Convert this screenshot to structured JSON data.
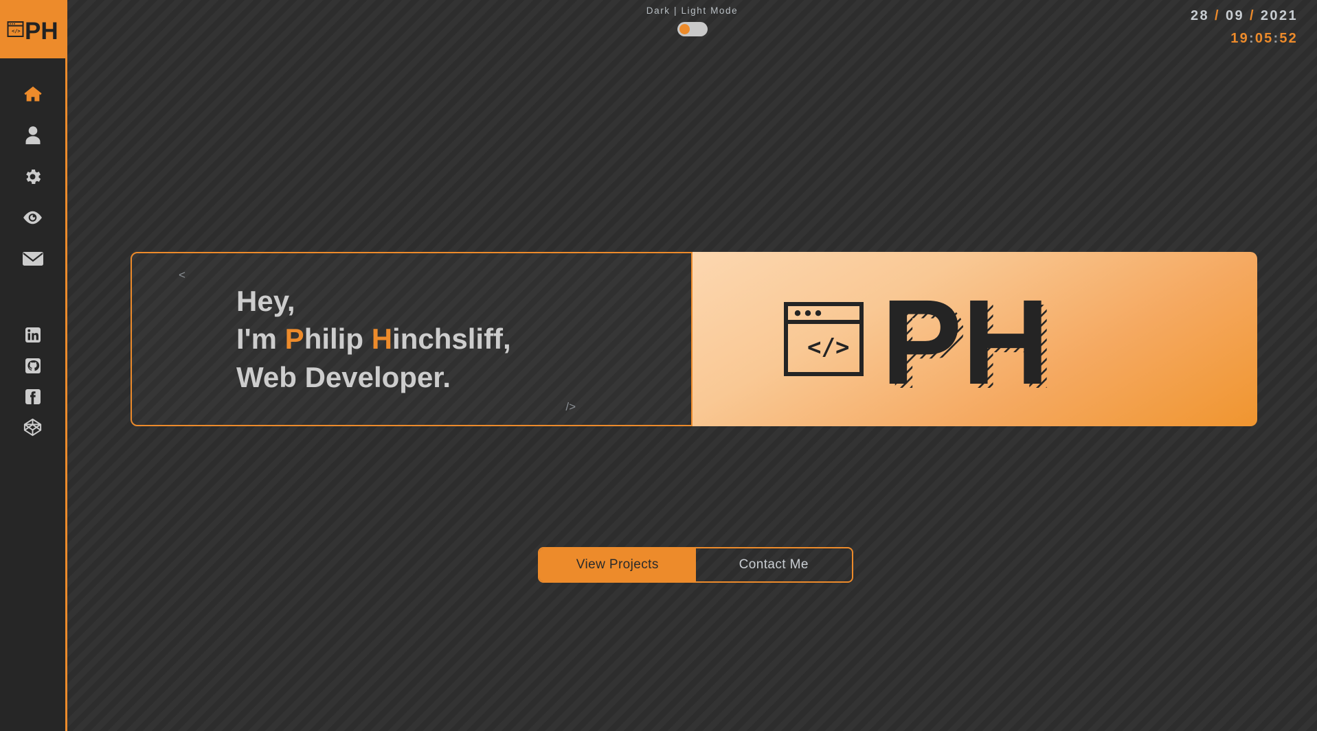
{
  "brand": {
    "initials": "PH",
    "code_glyph": "</>",
    "accent_color": "#ED8B2B",
    "sidebar_color": "#262626",
    "background_color": "#313131",
    "text_color": "#CDCDCD"
  },
  "sidebar": {
    "logo_name": "ph-logo",
    "nav_items": [
      {
        "name": "home",
        "icon": "home-icon",
        "active": true
      },
      {
        "name": "about",
        "icon": "person-icon",
        "active": false
      },
      {
        "name": "skills",
        "icon": "gear-icon",
        "active": false
      },
      {
        "name": "projects",
        "icon": "eye-icon",
        "active": false
      },
      {
        "name": "contact",
        "icon": "envelope-icon",
        "active": false
      }
    ],
    "social_items": [
      {
        "name": "linkedin",
        "icon": "linkedin-icon"
      },
      {
        "name": "github",
        "icon": "github-icon"
      },
      {
        "name": "facebook",
        "icon": "facebook-icon"
      },
      {
        "name": "codepen",
        "icon": "codepen-icon"
      }
    ]
  },
  "topbar": {
    "mode_label": "Dark | Light Mode",
    "toggle_state": "dark",
    "date": {
      "day": "28",
      "month": "09",
      "year": "2021",
      "separator": "/"
    },
    "time": {
      "hours": "19",
      "minutes": "05",
      "seconds": "52",
      "separator": ":"
    }
  },
  "hero": {
    "bracket_open": "<",
    "bracket_close": "/>",
    "line1": "Hey,",
    "line2_prefix": "I'm ",
    "line2_accent1": "P",
    "line2_mid1": "hilip ",
    "line2_accent2": "H",
    "line2_mid2": "inchsliff,",
    "line3": "Web Developer."
  },
  "cta": {
    "primary_label": "View Projects",
    "secondary_label": "Contact Me"
  }
}
